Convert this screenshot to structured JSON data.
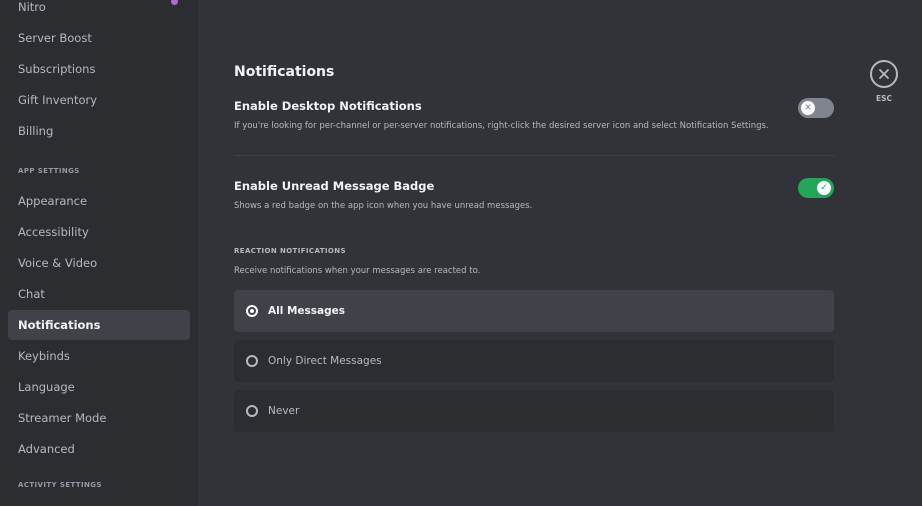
{
  "sidebar": {
    "top_items": [
      {
        "label": "Nitro"
      },
      {
        "label": "Server Boost"
      },
      {
        "label": "Subscriptions"
      },
      {
        "label": "Gift Inventory"
      },
      {
        "label": "Billing"
      }
    ],
    "app_settings_header": "APP SETTINGS",
    "app_items": [
      {
        "label": "Appearance"
      },
      {
        "label": "Accessibility"
      },
      {
        "label": "Voice & Video"
      },
      {
        "label": "Chat"
      },
      {
        "label": "Notifications"
      },
      {
        "label": "Keybinds"
      },
      {
        "label": "Language"
      },
      {
        "label": "Streamer Mode"
      },
      {
        "label": "Advanced"
      }
    ],
    "active_item": "Notifications",
    "activity_settings_header": "ACTIVITY SETTINGS"
  },
  "main": {
    "title": "Notifications",
    "desktop_notifications": {
      "title": "Enable Desktop Notifications",
      "description": "If you're looking for per-channel or per-server notifications, right-click the desired server icon and select Notification Settings.",
      "enabled": false,
      "knob_glyph": "✕"
    },
    "unread_badge": {
      "title": "Enable Unread Message Badge",
      "description": "Shows a red badge on the app icon when you have unread messages.",
      "enabled": true,
      "knob_glyph": "✓"
    },
    "reaction_notifications": {
      "label": "REACTION NOTIFICATIONS",
      "description": "Receive notifications when your messages are reacted to.",
      "options": [
        {
          "label": "All Messages",
          "selected": true
        },
        {
          "label": "Only Direct Messages",
          "selected": false
        },
        {
          "label": "Never",
          "selected": false
        }
      ]
    }
  },
  "close": {
    "label": "ESC"
  },
  "colors": {
    "sidebar_bg": "#2b2d31",
    "content_bg": "#313338",
    "active_item_bg": "#404249",
    "toggle_on": "#23a55a",
    "toggle_off": "#80848e",
    "nitro_dot": "#b266d9"
  }
}
